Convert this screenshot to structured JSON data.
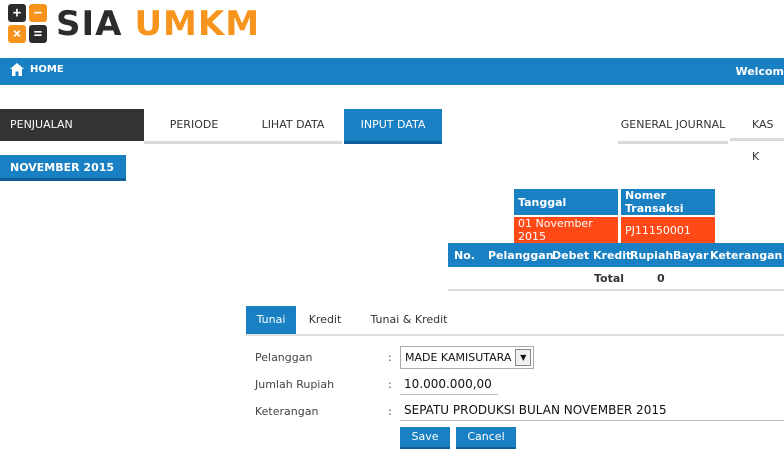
{
  "app": {
    "logo_left": "SIA",
    "logo_right": "UMKM"
  },
  "topbar": {
    "home_label": "HOME",
    "welcome_text": "Welcom"
  },
  "tabs": [
    {
      "label": "PENJUALAN"
    },
    {
      "label": "PERIODE"
    },
    {
      "label": "LIHAT DATA"
    },
    {
      "label": "INPUT DATA"
    },
    {
      "label": "GENERAL JOURNAL"
    },
    {
      "label": "KAS K"
    }
  ],
  "period": {
    "month": "NOVEMBER 2015"
  },
  "header_table": {
    "col_date": "Tanggal",
    "col_trx": "Nomer Transaksi",
    "date": "01 November 2015",
    "trx": "PJ11150001"
  },
  "detail_table": {
    "columns": [
      "No.",
      "Pelanggan",
      "Debet",
      "Kredit",
      "Rupiah",
      "Bayar",
      "Keterangan"
    ],
    "total_label": "Total",
    "total_value": "0"
  },
  "payment_tabs": [
    {
      "label": "Tunai"
    },
    {
      "label": "Kredit"
    },
    {
      "label": "Tunai & Kredit"
    }
  ],
  "form": {
    "customer_label": "Pelanggan",
    "customer_value": "MADE KAMISUTARA",
    "amount_label": "Jumlah Rupiah",
    "amount_value": "10.000.000,00",
    "note_label": "Keterangan",
    "note_value": "SEPATU PRODUKSI BULAN NOVEMBER 2015",
    "colon": ":"
  },
  "buttons": {
    "save": "Save",
    "cancel": "Cancel"
  },
  "colors": {
    "primary": "#1a80c4",
    "accent": "#f7941d",
    "highlight": "#ff4a17",
    "dark": "#333333"
  }
}
